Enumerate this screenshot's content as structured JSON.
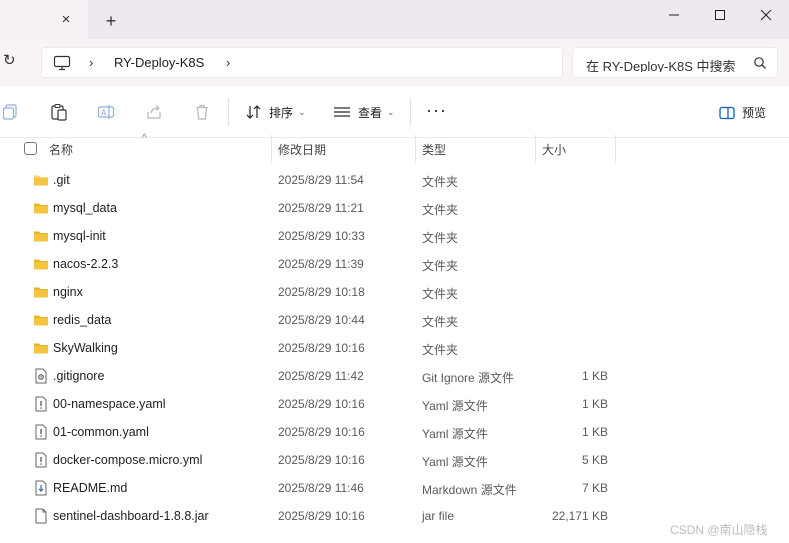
{
  "window": {
    "tab_close": "×",
    "tab_new": "+"
  },
  "address": {
    "breadcrumb_sep": "›",
    "folder": "RY-Deploy-K8S",
    "search_placeholder": "在 RY-Deploy-K8S 中搜索"
  },
  "toolbar": {
    "sort_label": "排序",
    "view_label": "查看",
    "more_label": "···",
    "preview_label": "预览"
  },
  "columns": {
    "name": "名称",
    "modified": "修改日期",
    "type": "类型",
    "size": "大小"
  },
  "files": [
    {
      "name": ".git",
      "modified": "2025/8/29 11:54",
      "type": "文件夹",
      "size": "",
      "icon": "folder-icon"
    },
    {
      "name": "mysql_data",
      "modified": "2025/8/29 11:21",
      "type": "文件夹",
      "size": "",
      "icon": "folder-icon"
    },
    {
      "name": "mysql-init",
      "modified": "2025/8/29 10:33",
      "type": "文件夹",
      "size": "",
      "icon": "folder-icon"
    },
    {
      "name": "nacos-2.2.3",
      "modified": "2025/8/29 11:39",
      "type": "文件夹",
      "size": "",
      "icon": "folder-icon"
    },
    {
      "name": "nginx",
      "modified": "2025/8/29 10:18",
      "type": "文件夹",
      "size": "",
      "icon": "folder-icon"
    },
    {
      "name": "redis_data",
      "modified": "2025/8/29 10:44",
      "type": "文件夹",
      "size": "",
      "icon": "folder-icon"
    },
    {
      "name": "SkyWalking",
      "modified": "2025/8/29 10:16",
      "type": "文件夹",
      "size": "",
      "icon": "folder-icon"
    },
    {
      "name": ".gitignore",
      "modified": "2025/8/29 11:42",
      "type": "Git Ignore 源文件",
      "size": "1 KB",
      "icon": "config-file-icon"
    },
    {
      "name": "00-namespace.yaml",
      "modified": "2025/8/29 10:16",
      "type": "Yaml 源文件",
      "size": "1 KB",
      "icon": "yaml-file-icon"
    },
    {
      "name": "01-common.yaml",
      "modified": "2025/8/29 10:16",
      "type": "Yaml 源文件",
      "size": "1 KB",
      "icon": "yaml-file-icon"
    },
    {
      "name": "docker-compose.micro.yml",
      "modified": "2025/8/29 10:16",
      "type": "Yaml 源文件",
      "size": "5 KB",
      "icon": "yaml-file-icon"
    },
    {
      "name": "README.md",
      "modified": "2025/8/29 11:46",
      "type": "Markdown 源文件",
      "size": "7 KB",
      "icon": "markdown-file-icon"
    },
    {
      "name": "sentinel-dashboard-1.8.8.jar",
      "modified": "2025/8/29 10:16",
      "type": "jar file",
      "size": "22,171 KB",
      "icon": "generic-file-icon"
    }
  ],
  "watermark": "CSDN @南山隐栈",
  "colors": {
    "folder": "#f5c542",
    "tabstrip": "#efe8ee",
    "addressbar": "#f7f3f6"
  }
}
